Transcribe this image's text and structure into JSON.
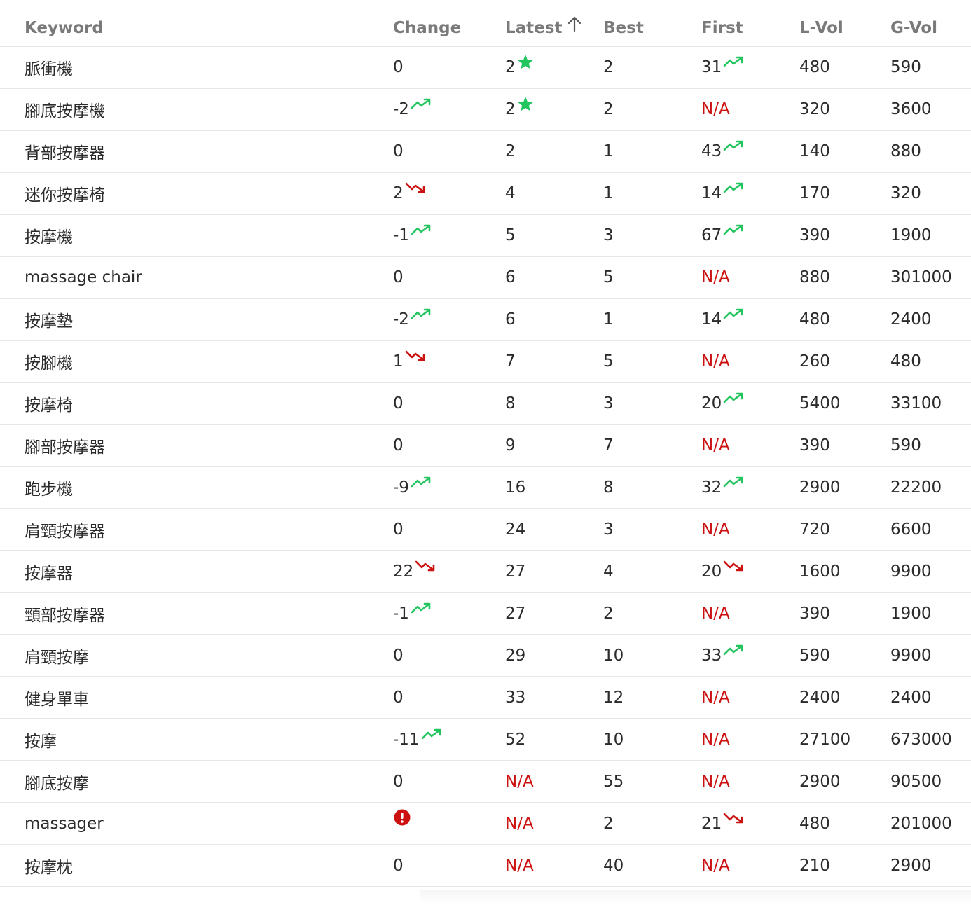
{
  "table": {
    "headers": {
      "keyword": "Keyword",
      "change": "Change",
      "latest": "Latest",
      "best": "Best",
      "first": "First",
      "l_vol": "L-Vol",
      "g_vol": "G-Vol"
    },
    "sort": {
      "column": "latest",
      "direction": "ascending",
      "icon": "arrow-up-icon"
    },
    "icon_legend": {
      "trend-up-icon": "#22c55e",
      "trend-down-icon": "#cc1111",
      "star-icon": "#22c55e",
      "alert-icon": "#cc1111"
    },
    "rows": [
      {
        "keyword": "脈衝機",
        "change": "0",
        "change_icon": null,
        "latest": "2",
        "latest_icon": "star-icon",
        "best": "2",
        "first": "31",
        "first_icon": "trend-up-icon",
        "l_vol": "480",
        "g_vol": "590"
      },
      {
        "keyword": "腳底按摩機",
        "change": "-2",
        "change_icon": "trend-up-icon",
        "latest": "2",
        "latest_icon": "star-icon",
        "best": "2",
        "first": "N/A",
        "first_icon": null,
        "l_vol": "320",
        "g_vol": "3600"
      },
      {
        "keyword": "背部按摩器",
        "change": "0",
        "change_icon": null,
        "latest": "2",
        "latest_icon": null,
        "best": "1",
        "first": "43",
        "first_icon": "trend-up-icon",
        "l_vol": "140",
        "g_vol": "880"
      },
      {
        "keyword": "迷你按摩椅",
        "change": "2",
        "change_icon": "trend-down-icon",
        "latest": "4",
        "latest_icon": null,
        "best": "1",
        "first": "14",
        "first_icon": "trend-up-icon",
        "l_vol": "170",
        "g_vol": "320"
      },
      {
        "keyword": "按摩機",
        "change": "-1",
        "change_icon": "trend-up-icon",
        "latest": "5",
        "latest_icon": null,
        "best": "3",
        "first": "67",
        "first_icon": "trend-up-icon",
        "l_vol": "390",
        "g_vol": "1900"
      },
      {
        "keyword": "massage chair",
        "change": "0",
        "change_icon": null,
        "latest": "6",
        "latest_icon": null,
        "best": "5",
        "first": "N/A",
        "first_icon": null,
        "l_vol": "880",
        "g_vol": "301000"
      },
      {
        "keyword": "按摩墊",
        "change": "-2",
        "change_icon": "trend-up-icon",
        "latest": "6",
        "latest_icon": null,
        "best": "1",
        "first": "14",
        "first_icon": "trend-up-icon",
        "l_vol": "480",
        "g_vol": "2400"
      },
      {
        "keyword": "按腳機",
        "change": "1",
        "change_icon": "trend-down-icon",
        "latest": "7",
        "latest_icon": null,
        "best": "5",
        "first": "N/A",
        "first_icon": null,
        "l_vol": "260",
        "g_vol": "480"
      },
      {
        "keyword": "按摩椅",
        "change": "0",
        "change_icon": null,
        "latest": "8",
        "latest_icon": null,
        "best": "3",
        "first": "20",
        "first_icon": "trend-up-icon",
        "l_vol": "5400",
        "g_vol": "33100"
      },
      {
        "keyword": "腳部按摩器",
        "change": "0",
        "change_icon": null,
        "latest": "9",
        "latest_icon": null,
        "best": "7",
        "first": "N/A",
        "first_icon": null,
        "l_vol": "390",
        "g_vol": "590"
      },
      {
        "keyword": "跑步機",
        "change": "-9",
        "change_icon": "trend-up-icon",
        "latest": "16",
        "latest_icon": null,
        "best": "8",
        "first": "32",
        "first_icon": "trend-up-icon",
        "l_vol": "2900",
        "g_vol": "22200"
      },
      {
        "keyword": "肩頸按摩器",
        "change": "0",
        "change_icon": null,
        "latest": "24",
        "latest_icon": null,
        "best": "3",
        "first": "N/A",
        "first_icon": null,
        "l_vol": "720",
        "g_vol": "6600"
      },
      {
        "keyword": "按摩器",
        "change": "22",
        "change_icon": "trend-down-icon",
        "latest": "27",
        "latest_icon": null,
        "best": "4",
        "first": "20",
        "first_icon": "trend-down-icon",
        "l_vol": "1600",
        "g_vol": "9900"
      },
      {
        "keyword": "頸部按摩器",
        "change": "-1",
        "change_icon": "trend-up-icon",
        "latest": "27",
        "latest_icon": null,
        "best": "2",
        "first": "N/A",
        "first_icon": null,
        "l_vol": "390",
        "g_vol": "1900"
      },
      {
        "keyword": "肩頸按摩",
        "change": "0",
        "change_icon": null,
        "latest": "29",
        "latest_icon": null,
        "best": "10",
        "first": "33",
        "first_icon": "trend-up-icon",
        "l_vol": "590",
        "g_vol": "9900"
      },
      {
        "keyword": "健身單車",
        "change": "0",
        "change_icon": null,
        "latest": "33",
        "latest_icon": null,
        "best": "12",
        "first": "N/A",
        "first_icon": null,
        "l_vol": "2400",
        "g_vol": "2400"
      },
      {
        "keyword": "按摩",
        "change": "-11",
        "change_icon": "trend-up-icon",
        "latest": "52",
        "latest_icon": null,
        "best": "10",
        "first": "N/A",
        "first_icon": null,
        "l_vol": "27100",
        "g_vol": "673000"
      },
      {
        "keyword": "腳底按摩",
        "change": "0",
        "change_icon": null,
        "latest": "N/A",
        "latest_icon": null,
        "best": "55",
        "first": "N/A",
        "first_icon": null,
        "l_vol": "2900",
        "g_vol": "90500"
      },
      {
        "keyword": "massager",
        "change": "",
        "change_icon": "alert-icon",
        "latest": "N/A",
        "latest_icon": null,
        "best": "2",
        "first": "21",
        "first_icon": "trend-down-icon",
        "l_vol": "480",
        "g_vol": "201000"
      },
      {
        "keyword": "按摩枕",
        "change": "0",
        "change_icon": null,
        "latest": "N/A",
        "latest_icon": null,
        "best": "40",
        "first": "N/A",
        "first_icon": null,
        "l_vol": "210",
        "g_vol": "2900"
      }
    ]
  }
}
